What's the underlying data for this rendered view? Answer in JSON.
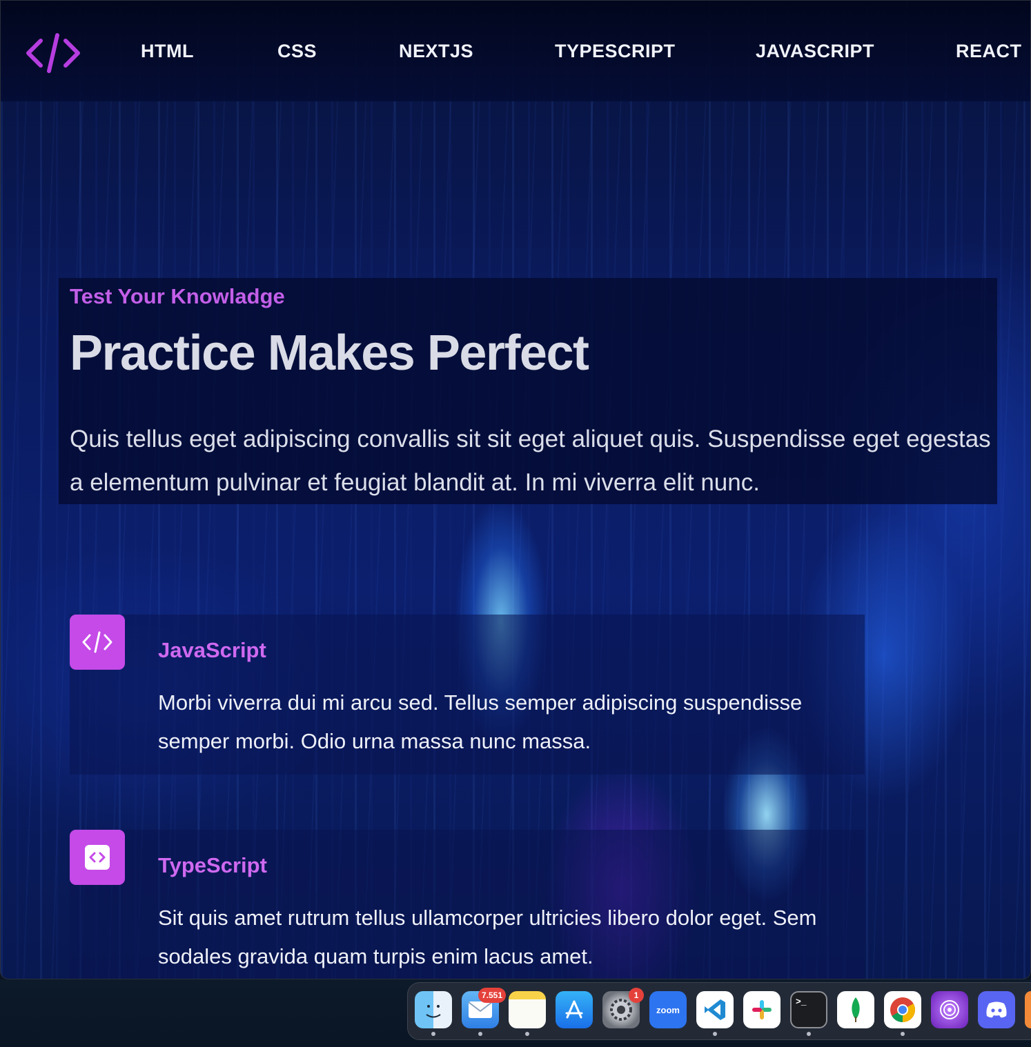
{
  "nav": {
    "items": [
      {
        "label": "HTML"
      },
      {
        "label": "CSS"
      },
      {
        "label": "NEXTJS"
      },
      {
        "label": "TYPESCRIPT"
      },
      {
        "label": "JAVASCRIPT"
      },
      {
        "label": "REACT"
      }
    ]
  },
  "hero": {
    "eyebrow": "Test Your Knowladge",
    "title": "Practice Makes Perfect",
    "description": "Quis tellus eget adipiscing convallis sit sit eget aliquet quis. Suspendisse eget egestas a elementum pulvinar et feugiat blandit at. In mi viverra elit nunc."
  },
  "features": [
    {
      "title": "JavaScript",
      "text": "Morbi viverra dui mi arcu sed. Tellus semper adipiscing suspendisse semper morbi. Odio urna massa nunc massa.",
      "icon": "code-slash-icon"
    },
    {
      "title": "TypeScript",
      "text": "Sit quis amet rutrum tellus ullamcorper ultricies libero dolor eget. Sem sodales gravida quam turpis enim lacus amet.",
      "icon": "code-brackets-icon"
    }
  ],
  "dock": {
    "apps": [
      {
        "name": "finder-icon"
      },
      {
        "name": "mail-icon",
        "badge": "7.551"
      },
      {
        "name": "notes-icon"
      },
      {
        "name": "app-store-icon"
      },
      {
        "name": "system-settings-icon",
        "badge": "1"
      },
      {
        "name": "zoom-icon",
        "label": "zoom"
      },
      {
        "name": "vscode-icon"
      },
      {
        "name": "slack-icon"
      },
      {
        "name": "terminal-icon",
        "label": ">_"
      },
      {
        "name": "mongodb-icon"
      },
      {
        "name": "chrome-icon"
      },
      {
        "name": "tor-browser-icon"
      },
      {
        "name": "discord-icon"
      }
    ]
  },
  "colors": {
    "accent": "#c54ae8",
    "eyebrow": "#c35fe8",
    "nav_bg": "#030a2e"
  }
}
